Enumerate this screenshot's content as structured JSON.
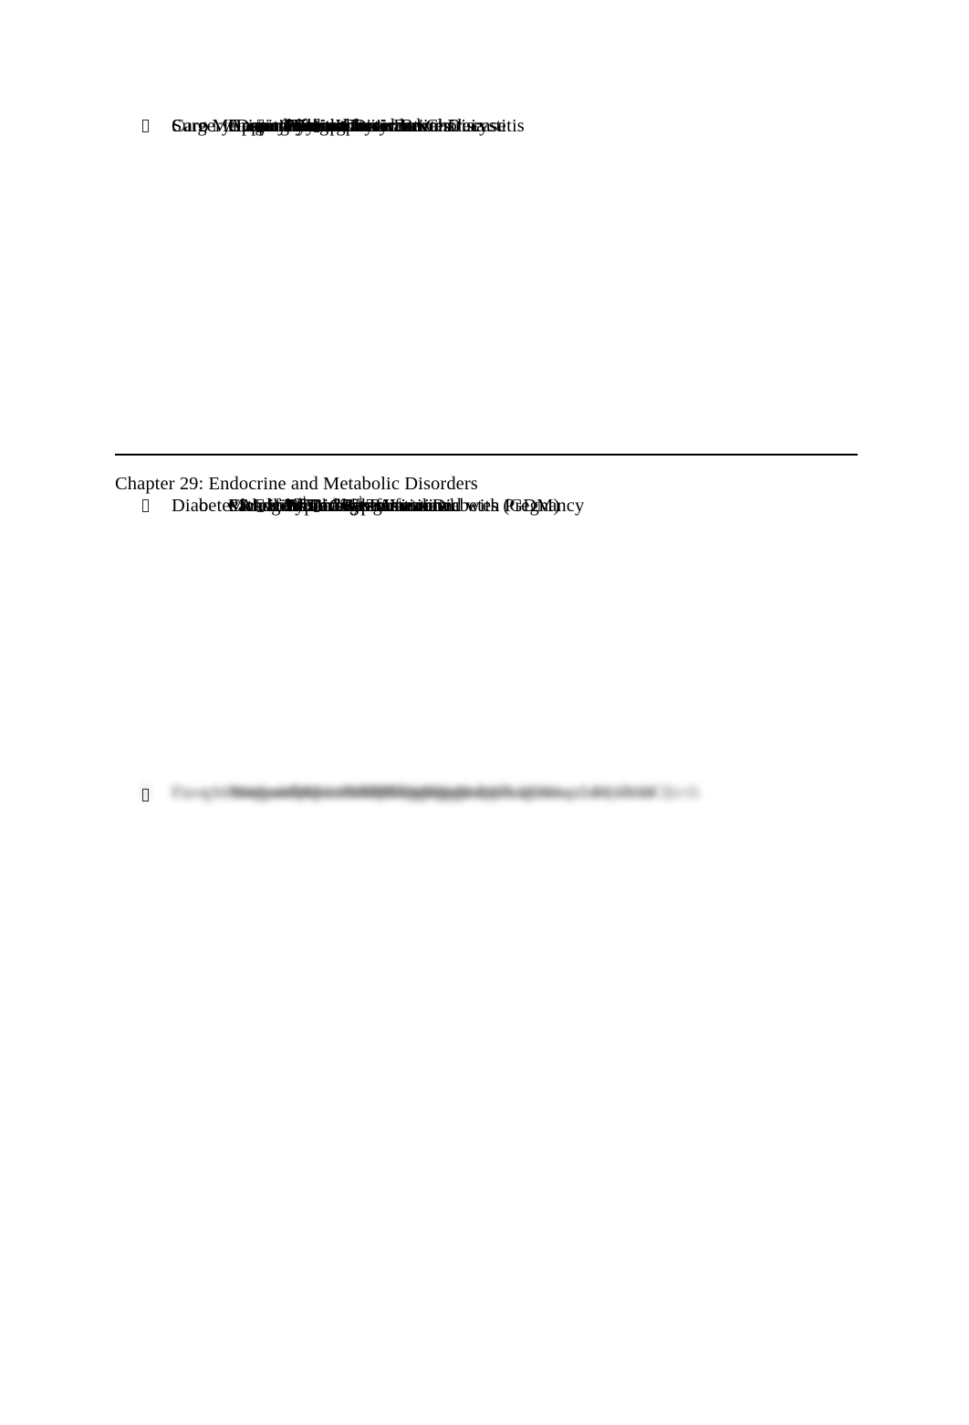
{
  "document": {
    "page_background": "#ffffff",
    "text_color": "#000000",
    "bullet_glyph": "missing-glyph-box",
    "marker_level2": "o",
    "rule_color": "#000000"
  },
  "section_previous": {
    "items": [
      {
        "level": 2,
        "marker": "o",
        "text": "Gastrointestinal Disorders"
      },
      {
        "level": 3,
        "marker": "tofu",
        "text": "Cholelithiasis and Cholecystitis"
      },
      {
        "level": 3,
        "marker": "tofu",
        "text": "Inflammatory Bowel Disease"
      },
      {
        "level": 2,
        "marker": "o",
        "text": "Urinary Tract Infections"
      },
      {
        "level": 3,
        "marker": "tofu",
        "text": "Asymptomatic Bacteriruia"
      },
      {
        "level": 3,
        "marker": "tofu",
        "text": "Cystitis"
      },
      {
        "level": 3,
        "marker": "tofu",
        "text": "Pyelonephritis"
      },
      {
        "level": 4,
        "marker": "tofu",
        "text": "Considerations"
      },
      {
        "level": 3,
        "marker": "tofu",
        "text": "Nursing Interventions"
      },
      {
        "level": 1,
        "marker": "tofu",
        "text": "Surgery During Pregnancy"
      },
      {
        "level": 2,
        "marker": "o",
        "text": "Appendicitis"
      },
      {
        "level": 1,
        "marker": "tofu",
        "text": "Care Management"
      },
      {
        "level": 2,
        "marker": "o",
        "text": "Hospital Care"
      },
      {
        "level": 2,
        "marker": "o",
        "text": "Home Care"
      }
    ]
  },
  "chapter": {
    "heading": "Chapter 29: Endocrine and Metabolic Disorders",
    "items": [
      {
        "level": 1,
        "marker": "tofu",
        "text": "Diabetes Mellitus"
      },
      {
        "level": 2,
        "marker": "o",
        "text": "Pathogenesis"
      },
      {
        "level": 2,
        "marker": "o",
        "text": "Classification"
      },
      {
        "level": 3,
        "marker": "tofu",
        "text": "Typical"
      },
      {
        "level": 4,
        "marker": "tofu",
        "text": "Type I"
      },
      {
        "level": 4,
        "marker": "tofu",
        "text": "Type II"
      },
      {
        "level": 4,
        "marker": "tofu",
        "text": "Pre-gestational"
      },
      {
        "level": 4,
        "marker": "tofu",
        "text": "Gestational Diabetes (GDM)"
      },
      {
        "level": 3,
        "marker": "tofu",
        "text": "White’s Classification"
      },
      {
        "level": 3,
        "marker": "tofu",
        "text": "ADA Classification"
      },
      {
        "level": 2,
        "marker": "o",
        "text": "Metabolic Changes Associated with Pregnancy"
      },
      {
        "level": 3,
        "marker": "tofu",
        "text_html": "1<sup>st</sup> Trimester"
      },
      {
        "level": 3,
        "marker": "tofu",
        "text_html": "2<sup>nd</sup> and 3<sup>rd</sup> Trimesters"
      }
    ]
  },
  "obscured_section": {
    "note": "blurred",
    "items": [
      {
        "level": 1,
        "marker": "tofu",
        "text": "Pre-gestational Diabetes Mellitus"
      },
      {
        "level": 2,
        "marker": "o",
        "text": "Preconception Counseling"
      },
      {
        "level": 2,
        "marker": "o",
        "text": "Maternal Risks and Complications"
      },
      {
        "level": 2,
        "marker": "o",
        "text": "Fetal and Neonatal Risks and Complications"
      },
      {
        "level": 1,
        "marker": "tofu",
        "text": "Care Management"
      },
      {
        "level": 2,
        "marker": "o",
        "text": "Antepartum and Nursing Diagnoses"
      },
      {
        "level": 2,
        "marker": "o",
        "text": "Interventions"
      },
      {
        "level": 3,
        "marker": "tofu",
        "text": "Outpatient"
      },
      {
        "level": 4,
        "marker": "tofu",
        "text": "Diet"
      },
      {
        "level": 4,
        "marker": "tofu",
        "text": "Exercise"
      },
      {
        "level": 4,
        "marker": "tofu",
        "text": "Insulin Therapy"
      },
      {
        "level": 4,
        "marker": "tofu",
        "text": "Self-Monitoring of Blood Glucose (SMBG)"
      },
      {
        "level": 4,
        "marker": "tofu",
        "text": "Urine Testing"
      },
      {
        "level": 4,
        "marker": "tofu",
        "text": "Complications Requiring Hospitalization"
      },
      {
        "level": 4,
        "marker": "tofu",
        "text": "Fetal Surveillance"
      },
      {
        "level": 4,
        "marker": "tofu",
        "text": "Determination of Birth Date and Mode of Birth"
      }
    ]
  }
}
